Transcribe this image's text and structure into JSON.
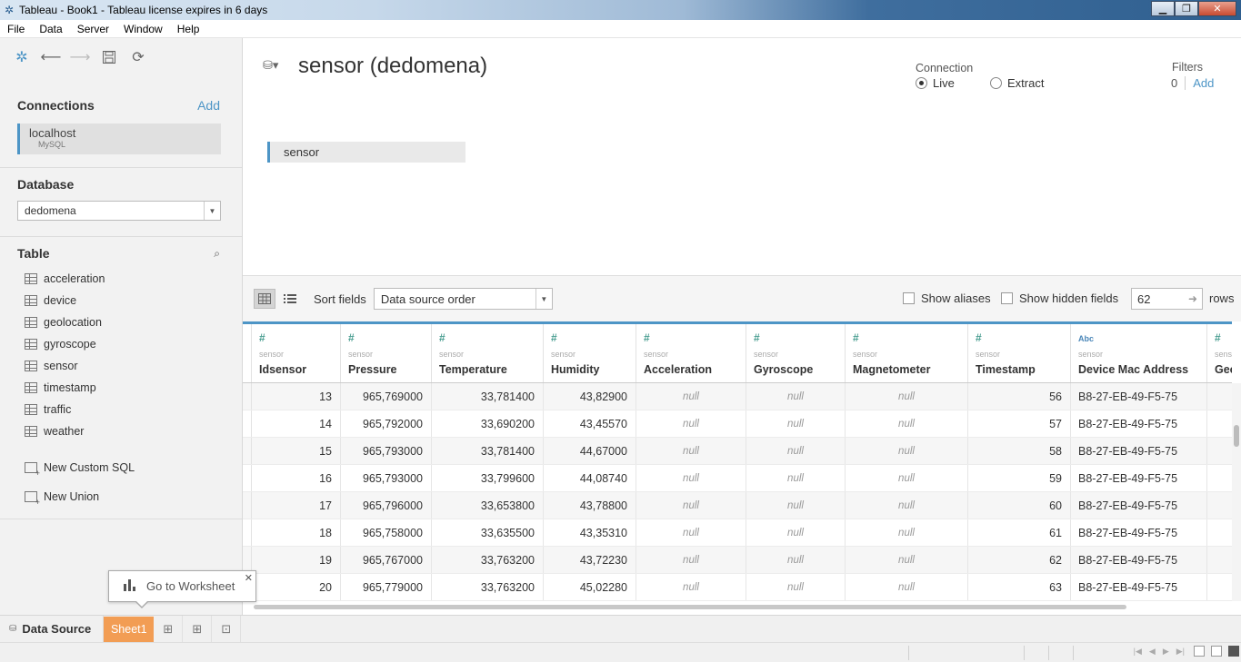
{
  "window": {
    "title": "Tableau - Book1 - Tableau license expires in 6 days"
  },
  "menu": [
    "File",
    "Data",
    "Server",
    "Window",
    "Help"
  ],
  "left": {
    "connections_title": "Connections",
    "add_label": "Add",
    "connection": {
      "name": "localhost",
      "type": "MySQL"
    },
    "database_title": "Database",
    "database_value": "dedomena",
    "table_title": "Table",
    "tables": [
      "acceleration",
      "device",
      "geolocation",
      "gyroscope",
      "sensor",
      "timestamp",
      "traffic",
      "weather"
    ],
    "new_custom_sql": "New Custom SQL",
    "new_union": "New Union"
  },
  "canvas": {
    "datasource_title": "sensor (dedomena)",
    "connection_label": "Connection",
    "live_label": "Live",
    "extract_label": "Extract",
    "filters_label": "Filters",
    "filters_count": "0",
    "filters_add": "Add",
    "table_chip": "sensor"
  },
  "gridbar": {
    "sort_label": "Sort fields",
    "sort_value": "Data source order",
    "show_aliases": "Show aliases",
    "show_hidden": "Show hidden fields",
    "rows_value": "62",
    "rows_label": "rows"
  },
  "grid": {
    "columns": [
      {
        "type": "#",
        "source": "sensor",
        "name": "Idsensor"
      },
      {
        "type": "#",
        "source": "sensor",
        "name": "Pressure"
      },
      {
        "type": "#",
        "source": "sensor",
        "name": "Temperature"
      },
      {
        "type": "#",
        "source": "sensor",
        "name": "Humidity"
      },
      {
        "type": "#",
        "source": "sensor",
        "name": "Acceleration"
      },
      {
        "type": "#",
        "source": "sensor",
        "name": "Gyroscope"
      },
      {
        "type": "#",
        "source": "sensor",
        "name": "Magnetometer"
      },
      {
        "type": "#",
        "source": "sensor",
        "name": "Timestamp"
      },
      {
        "type": "Abc",
        "source": "sensor",
        "name": "Device Mac Address"
      },
      {
        "type": "#",
        "source": "sensor",
        "name": "Geol"
      }
    ],
    "rows": [
      [
        "13",
        "965,769000",
        "33,781400",
        "43,82900",
        "null",
        "null",
        "null",
        "56",
        "B8-27-EB-49-F5-75",
        ""
      ],
      [
        "14",
        "965,792000",
        "33,690200",
        "43,45570",
        "null",
        "null",
        "null",
        "57",
        "B8-27-EB-49-F5-75",
        ""
      ],
      [
        "15",
        "965,793000",
        "33,781400",
        "44,67000",
        "null",
        "null",
        "null",
        "58",
        "B8-27-EB-49-F5-75",
        ""
      ],
      [
        "16",
        "965,793000",
        "33,799600",
        "44,08740",
        "null",
        "null",
        "null",
        "59",
        "B8-27-EB-49-F5-75",
        ""
      ],
      [
        "17",
        "965,796000",
        "33,653800",
        "43,78800",
        "null",
        "null",
        "null",
        "60",
        "B8-27-EB-49-F5-75",
        ""
      ],
      [
        "18",
        "965,758000",
        "33,635500",
        "43,35310",
        "null",
        "null",
        "null",
        "61",
        "B8-27-EB-49-F5-75",
        ""
      ],
      [
        "19",
        "965,767000",
        "33,763200",
        "43,72230",
        "null",
        "null",
        "null",
        "62",
        "B8-27-EB-49-F5-75",
        ""
      ],
      [
        "20",
        "965,779000",
        "33,763200",
        "45,02280",
        "null",
        "null",
        "null",
        "63",
        "B8-27-EB-49-F5-75",
        ""
      ]
    ]
  },
  "tabs": {
    "data_source": "Data Source",
    "sheet": "Sheet1"
  },
  "tooltip": {
    "text": "Go to Worksheet"
  },
  "colors": {
    "accent": "#4d95c6",
    "sheet_tab": "#f29d54",
    "type_number": "#4a9e91"
  }
}
